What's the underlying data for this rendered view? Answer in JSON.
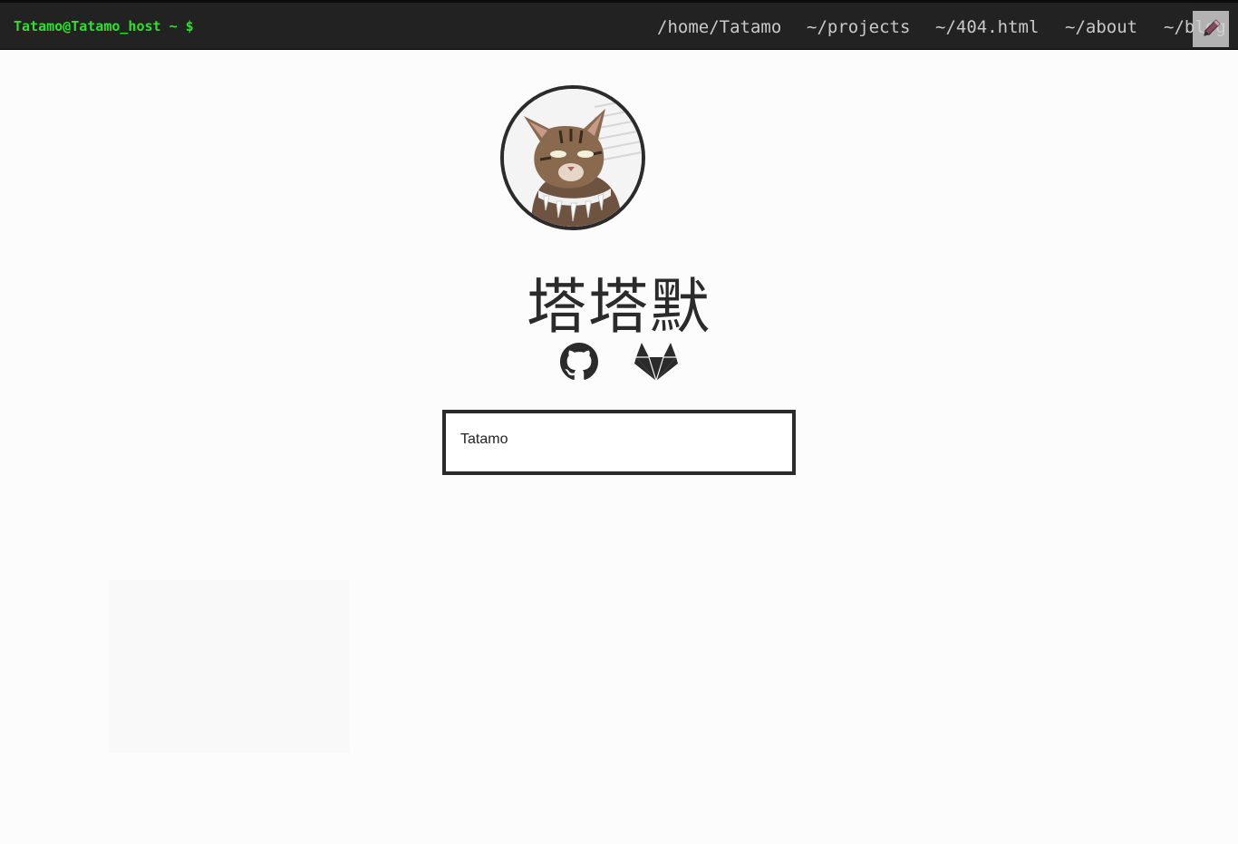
{
  "header": {
    "prompt": "Tatamo@Tatamo_host ~ $",
    "nav": [
      {
        "label": "/home/Tatamo"
      },
      {
        "label": "~/projects"
      },
      {
        "label": "~/404.html"
      },
      {
        "label": "~/about"
      },
      {
        "label": "~/blog"
      }
    ],
    "edit_icon": "pencil-icon"
  },
  "profile": {
    "avatar_icon": "cat-avatar",
    "name": "塔塔默",
    "social": [
      {
        "icon": "github-icon"
      },
      {
        "icon": "gitlab-icon"
      }
    ],
    "username": "Tatamo"
  },
  "colors": {
    "topbar": "#222222",
    "prompt": "#2be22b",
    "nav_text": "#c9c9c9",
    "ink": "#2b2b2b",
    "page_bg": "#fcfcfc"
  }
}
